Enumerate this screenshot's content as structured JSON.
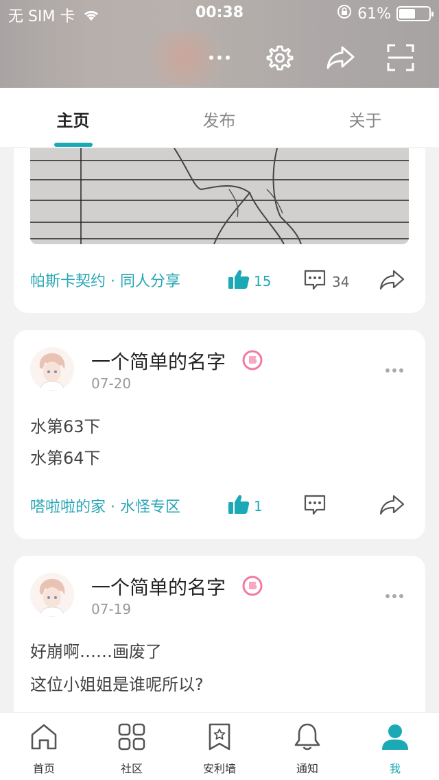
{
  "status_bar": {
    "carrier": "无 SIM 卡",
    "time": "00:38",
    "battery": "61%",
    "battery_level": 0.61
  },
  "header_icons": {
    "more": "more-icon",
    "settings": "gear-icon",
    "share": "share-icon",
    "scan": "scan-icon"
  },
  "tabs": [
    {
      "label": "主页",
      "active": true
    },
    {
      "label": "发布",
      "active": false
    },
    {
      "label": "关于",
      "active": false
    }
  ],
  "posts": [
    {
      "topic": "帕斯卡契约 · 同人分享",
      "likes": "15",
      "comments": "34"
    },
    {
      "username": "一个简单的名字",
      "date": "07-20",
      "lines": [
        "水第63下",
        "水第64下"
      ],
      "topic": "嗒啦啦的家 · 水怪专区",
      "likes": "1",
      "comments": ""
    },
    {
      "username": "一个简单的名字",
      "date": "07-19",
      "lines": [
        "好崩啊……画废了",
        "这位小姐姐是谁呢所以?"
      ]
    }
  ],
  "bottom_nav": [
    {
      "label": "首页",
      "icon": "home-icon",
      "active": false
    },
    {
      "label": "社区",
      "icon": "grid-icon",
      "active": false
    },
    {
      "label": "安利墙",
      "icon": "bookmark-star-icon",
      "active": false
    },
    {
      "label": "通知",
      "icon": "bell-icon",
      "active": false
    },
    {
      "label": "我",
      "icon": "person-icon",
      "active": true
    }
  ],
  "colors": {
    "accent": "#1ba9b5",
    "topic": "#27a7b4",
    "badge": "#f07aa5"
  }
}
